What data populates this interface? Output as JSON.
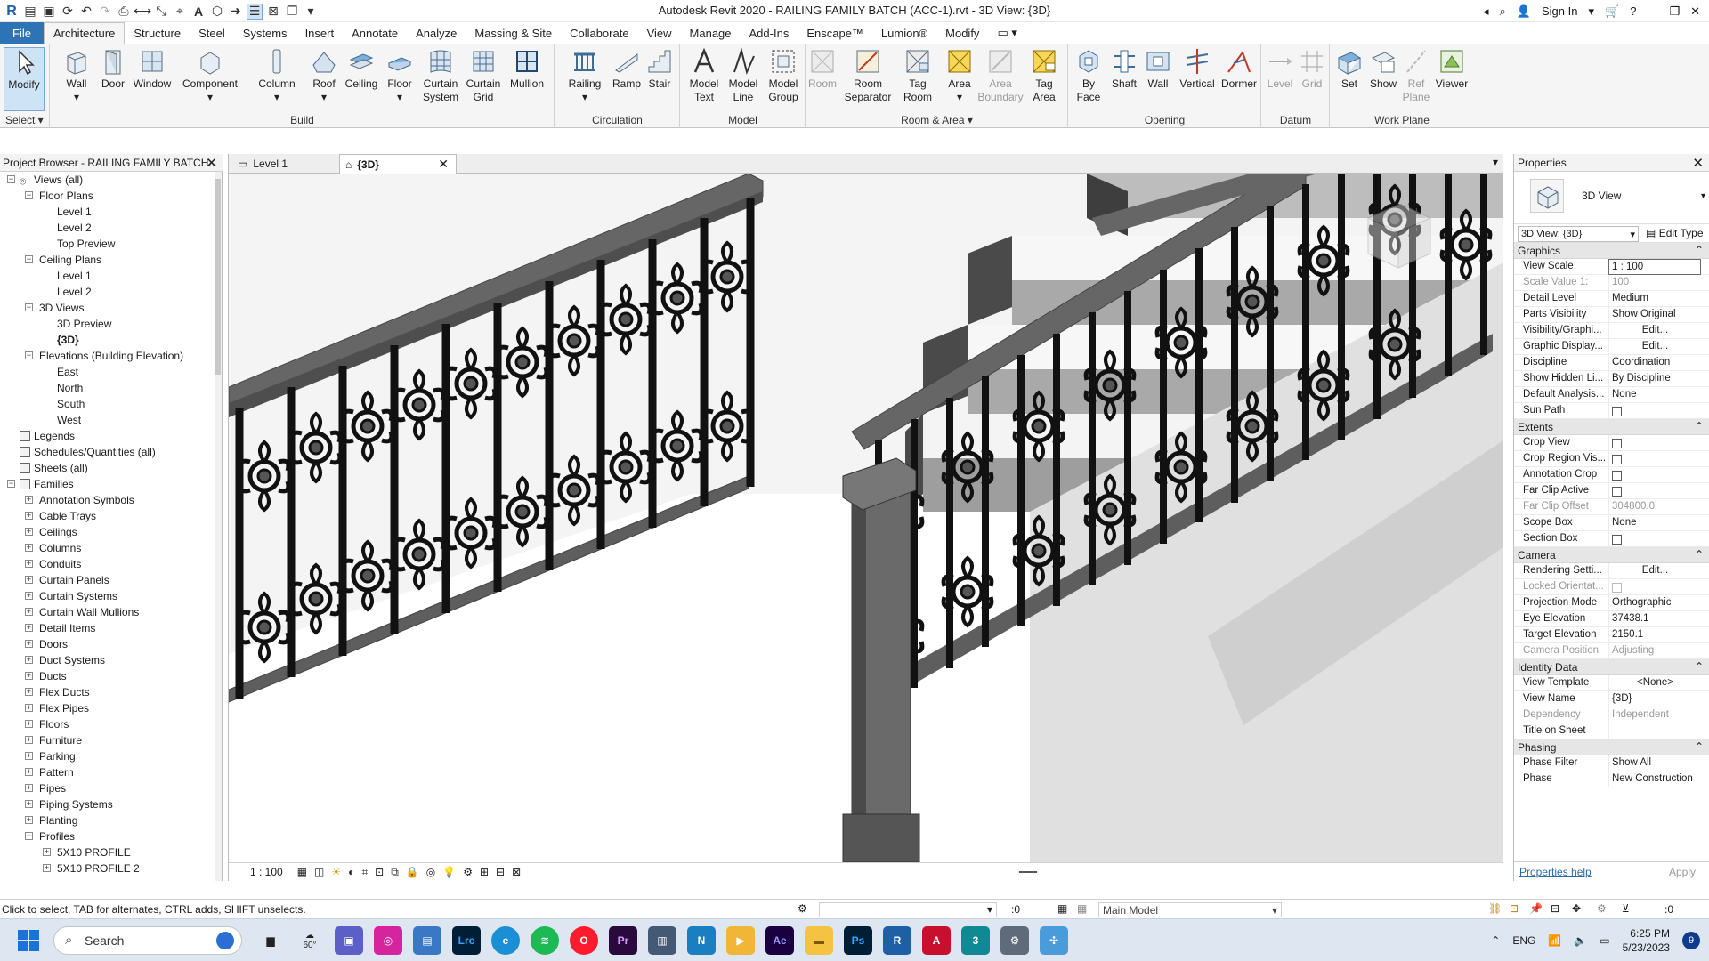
{
  "title_bar": {
    "app_title": "Autodesk Revit 2020 - RAILING FAMILY BATCH (ACC-1).rvt - 3D View: {3D}",
    "sign_in_label": "Sign In"
  },
  "menu": {
    "tabs": [
      "File",
      "Architecture",
      "Structure",
      "Steel",
      "Systems",
      "Insert",
      "Annotate",
      "Analyze",
      "Massing & Site",
      "Collaborate",
      "View",
      "Manage",
      "Add-Ins",
      "Enscape™",
      "Lumion®",
      "Modify"
    ],
    "active": "Architecture"
  },
  "ribbon": {
    "select": {
      "modify_label": "Modify",
      "panel_label": "Select ▾"
    },
    "build": {
      "panel_label": "Build",
      "tools": [
        "Wall",
        "Door",
        "Window",
        "Component",
        "Column",
        "Roof",
        "Ceiling",
        "Floor",
        "Curtain System",
        "Curtain Grid",
        "Mullion"
      ]
    },
    "circulation": {
      "panel_label": "Circulation",
      "tools": [
        "Railing",
        "Ramp",
        "Stair"
      ]
    },
    "model": {
      "panel_label": "Model",
      "tools": [
        "Model Text",
        "Model Line",
        "Model Group"
      ]
    },
    "room_area": {
      "panel_label": "Room & Area ▾",
      "tools": [
        "Room",
        "Room Separator",
        "Tag Room",
        "Area",
        "Area Boundary",
        "Tag Area"
      ]
    },
    "opening": {
      "panel_label": "Opening",
      "tools": [
        "By Face",
        "Shaft",
        "Wall",
        "Vertical",
        "Dormer"
      ]
    },
    "datum": {
      "panel_label": "Datum",
      "tools": [
        "Level",
        "Grid"
      ]
    },
    "work_plane": {
      "panel_label": "Work Plane",
      "tools": [
        "Set",
        "Show",
        "Ref Plane",
        "Viewer"
      ]
    }
  },
  "project_browser": {
    "title": "Project Browser - RAILING FAMILY BATCH...",
    "nodes": [
      {
        "label": "Views (all)",
        "level": 0,
        "toggle": "−"
      },
      {
        "label": "Floor Plans",
        "level": 1,
        "toggle": "−"
      },
      {
        "label": "Level 1",
        "level": 2,
        "toggle": ""
      },
      {
        "label": "Level 2",
        "level": 2,
        "toggle": ""
      },
      {
        "label": "Top Preview",
        "level": 2,
        "toggle": ""
      },
      {
        "label": "Ceiling Plans",
        "level": 1,
        "toggle": "−"
      },
      {
        "label": "Level 1",
        "level": 2,
        "toggle": ""
      },
      {
        "label": "Level 2",
        "level": 2,
        "toggle": ""
      },
      {
        "label": "3D Views",
        "level": 1,
        "toggle": "−"
      },
      {
        "label": "3D Preview",
        "level": 2,
        "toggle": ""
      },
      {
        "label": "{3D}",
        "level": 2,
        "toggle": "",
        "bold": true
      },
      {
        "label": "Elevations (Building Elevation)",
        "level": 1,
        "toggle": "−"
      },
      {
        "label": "East",
        "level": 2,
        "toggle": ""
      },
      {
        "label": "North",
        "level": 2,
        "toggle": ""
      },
      {
        "label": "South",
        "level": 2,
        "toggle": ""
      },
      {
        "label": "West",
        "level": 2,
        "toggle": ""
      },
      {
        "label": "Legends",
        "level": 0,
        "toggle": "",
        "icon": true
      },
      {
        "label": "Schedules/Quantities (all)",
        "level": 0,
        "toggle": "",
        "icon": true
      },
      {
        "label": "Sheets (all)",
        "level": 0,
        "toggle": "",
        "icon": true
      },
      {
        "label": "Families",
        "level": 0,
        "toggle": "−",
        "icon": true
      },
      {
        "label": "Annotation Symbols",
        "level": 1,
        "toggle": "+"
      },
      {
        "label": "Cable Trays",
        "level": 1,
        "toggle": "+"
      },
      {
        "label": "Ceilings",
        "level": 1,
        "toggle": "+"
      },
      {
        "label": "Columns",
        "level": 1,
        "toggle": "+"
      },
      {
        "label": "Conduits",
        "level": 1,
        "toggle": "+"
      },
      {
        "label": "Curtain Panels",
        "level": 1,
        "toggle": "+"
      },
      {
        "label": "Curtain Systems",
        "level": 1,
        "toggle": "+"
      },
      {
        "label": "Curtain Wall Mullions",
        "level": 1,
        "toggle": "+"
      },
      {
        "label": "Detail Items",
        "level": 1,
        "toggle": "+"
      },
      {
        "label": "Doors",
        "level": 1,
        "toggle": "+"
      },
      {
        "label": "Duct Systems",
        "level": 1,
        "toggle": "+"
      },
      {
        "label": "Ducts",
        "level": 1,
        "toggle": "+"
      },
      {
        "label": "Flex Ducts",
        "level": 1,
        "toggle": "+"
      },
      {
        "label": "Flex Pipes",
        "level": 1,
        "toggle": "+"
      },
      {
        "label": "Floors",
        "level": 1,
        "toggle": "+"
      },
      {
        "label": "Furniture",
        "level": 1,
        "toggle": "+"
      },
      {
        "label": "Parking",
        "level": 1,
        "toggle": "+"
      },
      {
        "label": "Pattern",
        "level": 1,
        "toggle": "+"
      },
      {
        "label": "Pipes",
        "level": 1,
        "toggle": "+"
      },
      {
        "label": "Piping Systems",
        "level": 1,
        "toggle": "+"
      },
      {
        "label": "Planting",
        "level": 1,
        "toggle": "+"
      },
      {
        "label": "Profiles",
        "level": 1,
        "toggle": "−"
      },
      {
        "label": "5X10 PROFILE",
        "level": 2,
        "toggle": "+"
      },
      {
        "label": "5X10 PROFILE 2",
        "level": 2,
        "toggle": "+"
      }
    ]
  },
  "view_tabs": [
    {
      "label": "Level 1",
      "active": false
    },
    {
      "label": "{3D}",
      "active": true
    }
  ],
  "view_bar": {
    "scale": "1 : 100"
  },
  "properties": {
    "title": "Properties",
    "type_name": "3D View",
    "filter": "3D View: {3D}",
    "edit_type": "Edit Type",
    "groups": [
      {
        "name": "Graphics",
        "rows": [
          {
            "k": "View Scale",
            "v": "1 : 100",
            "edit": true
          },
          {
            "k": "Scale Value    1:",
            "v": "100",
            "dim": true
          },
          {
            "k": "Detail Level",
            "v": "Medium"
          },
          {
            "k": "Parts Visibility",
            "v": "Show Original"
          },
          {
            "k": "Visibility/Graphi...",
            "v": "Edit...",
            "btn": true
          },
          {
            "k": "Graphic Display...",
            "v": "Edit...",
            "btn": true
          },
          {
            "k": "Discipline",
            "v": "Coordination"
          },
          {
            "k": "Show Hidden Li...",
            "v": "By Discipline"
          },
          {
            "k": "Default Analysis...",
            "v": "None"
          },
          {
            "k": "Sun Path",
            "v": "",
            "chk": true
          }
        ]
      },
      {
        "name": "Extents",
        "rows": [
          {
            "k": "Crop View",
            "v": "",
            "chk": true
          },
          {
            "k": "Crop Region Vis...",
            "v": "",
            "chk": true
          },
          {
            "k": "Annotation Crop",
            "v": "",
            "chk": true
          },
          {
            "k": "Far Clip Active",
            "v": "",
            "chk": true
          },
          {
            "k": "Far Clip Offset",
            "v": "304800.0",
            "dim": true
          },
          {
            "k": "Scope Box",
            "v": "None"
          },
          {
            "k": "Section Box",
            "v": "",
            "chk": true
          }
        ]
      },
      {
        "name": "Camera",
        "rows": [
          {
            "k": "Rendering Setti...",
            "v": "Edit...",
            "btn": true
          },
          {
            "k": "Locked Orientat...",
            "v": "",
            "chk": true,
            "dim": true
          },
          {
            "k": "Projection Mode",
            "v": "Orthographic"
          },
          {
            "k": "Eye Elevation",
            "v": "37438.1"
          },
          {
            "k": "Target Elevation",
            "v": "2150.1"
          },
          {
            "k": "Camera Position",
            "v": "Adjusting",
            "dim": true
          }
        ]
      },
      {
        "name": "Identity Data",
        "rows": [
          {
            "k": "View Template",
            "v": "<None>",
            "btn": true
          },
          {
            "k": "View Name",
            "v": "{3D}"
          },
          {
            "k": "Dependency",
            "v": "Independent",
            "dim": true
          },
          {
            "k": "Title on Sheet",
            "v": ""
          }
        ]
      },
      {
        "name": "Phasing",
        "rows": [
          {
            "k": "Phase Filter",
            "v": "Show All"
          },
          {
            "k": "Phase",
            "v": "New Construction"
          }
        ]
      }
    ],
    "help_link": "Properties help",
    "apply": "Apply"
  },
  "status_bar": {
    "message": "Click to select, TAB for alternates, CTRL adds, SHIFT unselects.",
    "count": ":0",
    "model": "Main Model",
    "filter_count": ":0"
  },
  "taskbar": {
    "search": "Search",
    "weather": "60°",
    "language": "ENG",
    "time": "6:25 PM",
    "date": "5/23/2023",
    "badge": "9"
  }
}
